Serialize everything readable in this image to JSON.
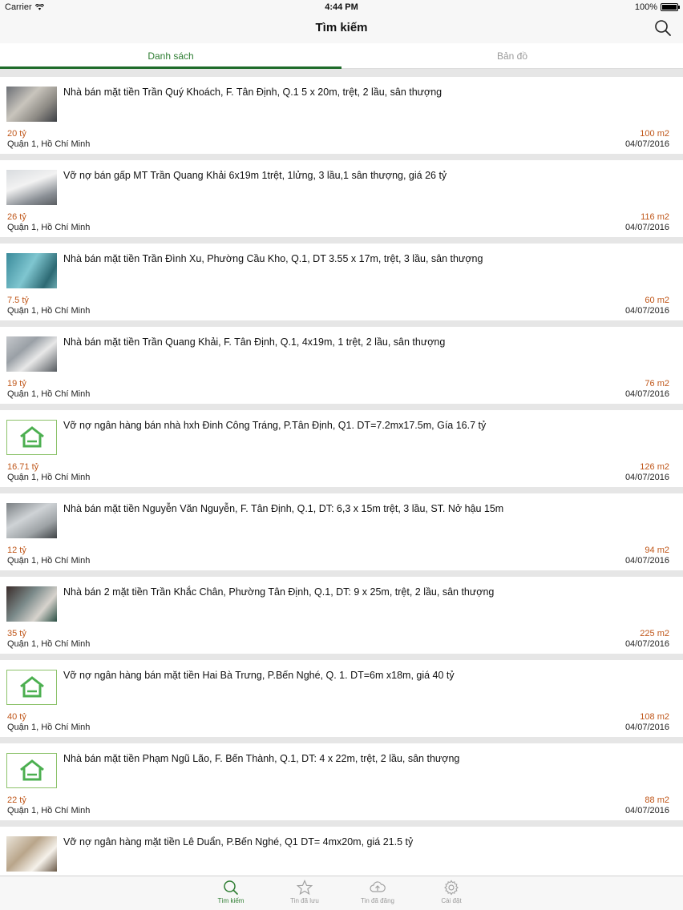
{
  "status_bar": {
    "carrier": "Carrier",
    "time": "4:44 PM",
    "battery": "100%"
  },
  "nav": {
    "title": "Tìm kiếm",
    "search_icon": "search-icon"
  },
  "tabs": [
    {
      "label": "Danh sách",
      "active": true
    },
    {
      "label": "Bản đồ",
      "active": false
    }
  ],
  "listings": [
    {
      "title": "Nhà bán mặt tiền Trần Quý Khoách, F. Tân Định, Q.1 5 x 20m, trệt, 2 lầu, sân thượng",
      "price": "20 tỷ",
      "area": "100 m2",
      "location": "Quận 1, Hồ Chí Minh",
      "date": "04/07/2016",
      "thumb": "photo"
    },
    {
      "title": "Vỡ nợ bán gấp MT Trần Quang Khải 6x19m 1trệt, 1lửng, 3 lầu,1 sân thượng, giá 26  tỷ",
      "price": "26 tỷ",
      "area": "116 m2",
      "location": "Quận 1, Hồ Chí Minh",
      "date": "04/07/2016",
      "thumb": "photo"
    },
    {
      "title": "Nhà bán mặt tiền Trần Đình Xu, Phường Cầu Kho, Q.1, DT 3.55 x 17m, trệt, 3 lầu, sân thượng",
      "price": "7.5 tỷ",
      "area": "60 m2",
      "location": "Quận 1, Hồ Chí Minh",
      "date": "04/07/2016",
      "thumb": "photo"
    },
    {
      "title": "Nhà bán mặt tiền Trần Quang Khải, F. Tân Định, Q.1, 4x19m, 1 trệt, 2 lầu, sân thượng",
      "price": "19 tỷ",
      "area": "76 m2",
      "location": "Quận 1, Hồ Chí Minh",
      "date": "04/07/2016",
      "thumb": "photo"
    },
    {
      "title": "Vỡ nợ ngân hàng bán nhà hxh Đinh Công Tráng, P.Tân Định, Q1. DT=7.2mx17.5m, Gía 16.7 tỷ",
      "price": "16.71 tỷ",
      "area": "126 m2",
      "location": "Quận 1, Hồ Chí Minh",
      "date": "04/07/2016",
      "thumb": "placeholder"
    },
    {
      "title": "Nhà bán mặt tiền Nguyễn Văn Nguyễn, F. Tân Định, Q.1, DT: 6,3 x 15m trệt, 3 lầu, ST. Nở hậu 15m",
      "price": "12 tỷ",
      "area": "94 m2",
      "location": "Quận 1, Hồ Chí Minh",
      "date": "04/07/2016",
      "thumb": "photo"
    },
    {
      "title": "Nhà bán 2 mặt tiền Trần Khắc Chân, Phường Tân Định, Q.1, DT: 9 x 25m, trệt, 2 lầu, sân thượng",
      "price": "35 tỷ",
      "area": "225 m2",
      "location": "Quận 1, Hồ Chí Minh",
      "date": "04/07/2016",
      "thumb": "photo"
    },
    {
      "title": "Vỡ nợ ngân hàng bán mặt tiền Hai Bà Trưng, P.Bến Nghé, Q. 1. DT=6m x18m, giá 40 tỷ",
      "price": "40 tỷ",
      "area": "108 m2",
      "location": "Quận 1, Hồ Chí Minh",
      "date": "04/07/2016",
      "thumb": "placeholder"
    },
    {
      "title": "Nhà bán mặt tiền Phạm Ngũ Lão, F. Bến Thành, Q.1, DT: 4 x 22m, trệt, 2 lầu, sân thượng",
      "price": "22 tỷ",
      "area": "88 m2",
      "location": "Quận 1, Hồ Chí Minh",
      "date": "04/07/2016",
      "thumb": "placeholder"
    },
    {
      "title": "Vỡ nợ ngân hàng mặt tiền Lê Duẩn, P.Bến Nghé, Q1 DT= 4mx20m, giá 21.5 tỷ",
      "price": "",
      "area": "",
      "location": "",
      "date": "",
      "thumb": "photo"
    }
  ],
  "tabbar": [
    {
      "label": "Tìm kiếm",
      "icon": "search-icon",
      "active": true
    },
    {
      "label": "Tin đã lưu",
      "icon": "star-icon",
      "active": false
    },
    {
      "label": "Tin đã đăng",
      "icon": "cloud-upload-icon",
      "active": false
    },
    {
      "label": "Cài đặt",
      "icon": "gear-icon",
      "active": false
    }
  ],
  "colors": {
    "accent": "#2e7d32",
    "price": "#c0571a",
    "placeholder_border": "#8cc26a"
  }
}
